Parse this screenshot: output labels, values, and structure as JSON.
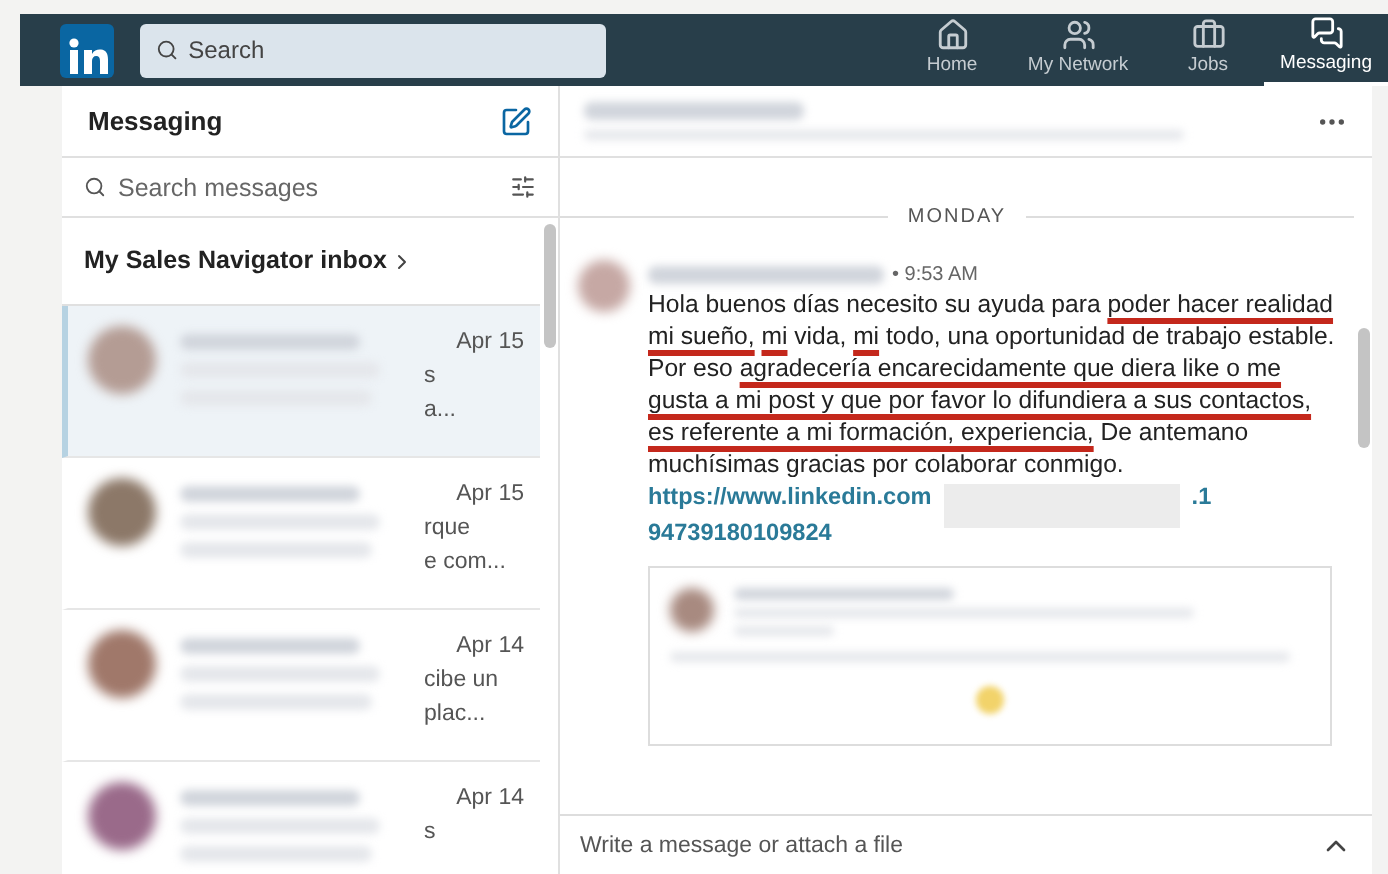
{
  "nav": {
    "search_placeholder": "Search",
    "items": [
      {
        "label": "Home",
        "selected": false
      },
      {
        "label": "My Network",
        "selected": false
      },
      {
        "label": "Jobs",
        "selected": false
      },
      {
        "label": "Messaging",
        "selected": true
      }
    ]
  },
  "sidebar": {
    "title": "Messaging",
    "search_placeholder": "Search messages",
    "inbox_link": "My Sales Navigator inbox",
    "conversations": [
      {
        "date": "Apr 15",
        "preview_fragments": [
          "s",
          "a..."
        ],
        "selected": true
      },
      {
        "date": "Apr 15",
        "preview_fragments": [
          "rque",
          "e com..."
        ],
        "selected": false
      },
      {
        "date": "Apr 14",
        "preview_fragments": [
          "cibe un",
          "plac..."
        ],
        "selected": false
      },
      {
        "date": "Apr 14",
        "preview_fragments": [
          "s"
        ],
        "selected": false
      }
    ]
  },
  "conversation": {
    "day_label": "MONDAY",
    "message": {
      "time": "• 9:53 AM",
      "segments": [
        {
          "text": "Hola buenos días necesito su ayuda para",
          "underlined": false
        },
        {
          "text": "poder hacer realidad mi sueño,",
          "underlined": true
        },
        {
          "text": "mi",
          "underlined": true
        },
        {
          "text": "vida,",
          "underlined": false
        },
        {
          "text": "mi",
          "underlined": true
        },
        {
          "text": "todo, una oportunidad de trabajo estable. Por eso",
          "underlined": false
        },
        {
          "text": "agradecería encarecidamente que diera like o me gusta a mi post y que por favor lo difundiera a sus contactos, es referente a mi formación, experiencia,",
          "underlined": true
        },
        {
          "text": "De antemano muchísimas gracias por colaborar conmigo.",
          "underlined": false
        }
      ],
      "link_start": "https://www.linkedin.com",
      "link_mid": ".1",
      "link_end": "94739180109824"
    }
  },
  "composer": {
    "placeholder": "Write a message or attach a file"
  }
}
